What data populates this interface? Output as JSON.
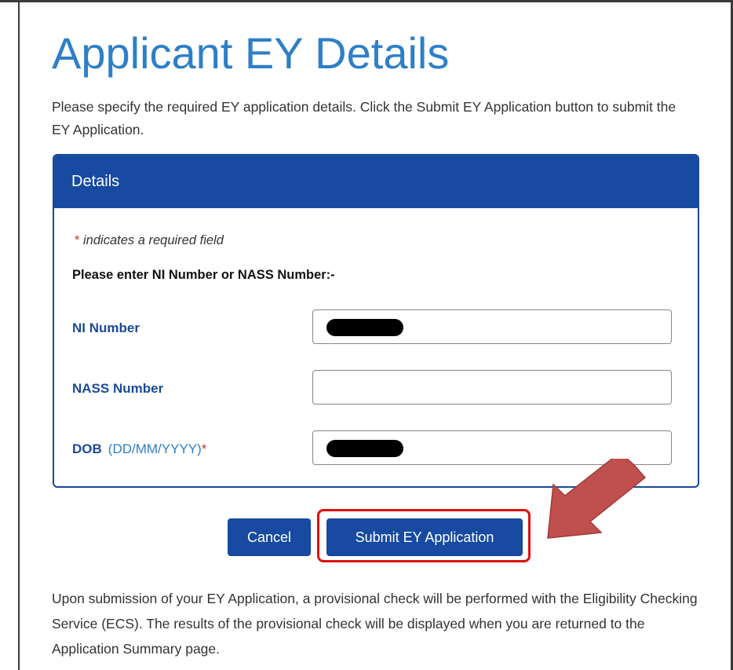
{
  "page": {
    "title": "Applicant EY Details",
    "intro": "Please specify the required EY application details. Click the Submit EY Application button to submit the EY Application.",
    "outro": "Upon submission of your EY Application, a provisional check will be performed with the Eligibility Checking Service (ECS). The results of the provisional check will be displayed when you are returned to the Application Summary page."
  },
  "panel": {
    "header": "Details",
    "required_star": "*",
    "required_note": "indicates a required field",
    "prompt": "Please enter NI Number or NASS Number:-"
  },
  "fields": {
    "ni": {
      "label": "NI Number",
      "value": ""
    },
    "nass": {
      "label": "NASS Number",
      "value": ""
    },
    "dob": {
      "label": "DOB",
      "hint": "(DD/MM/YYYY)",
      "star": "*",
      "value": ""
    }
  },
  "buttons": {
    "cancel": "Cancel",
    "submit": "Submit EY Application"
  },
  "colors": {
    "title_blue": "#2e7fc8",
    "panel_header": "#174aa0",
    "highlight_red": "#e01010",
    "arrow": "#c0504d"
  }
}
